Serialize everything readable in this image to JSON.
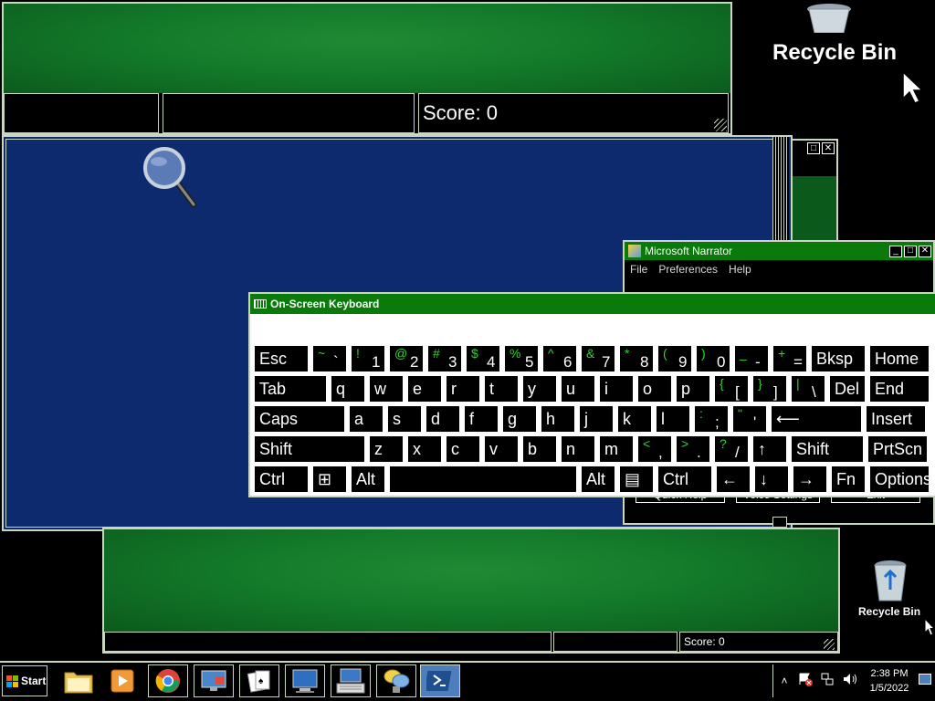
{
  "desktop": {
    "recycle_bin_top": "Recycle Bin",
    "recycle_bin_bottom": "Recycle Bin"
  },
  "solitaire_top": {
    "score": "Score: 0"
  },
  "solitaire_bottom": {
    "score": "Score: 0"
  },
  "osk": {
    "title": "On-Screen Keyboard",
    "rows": [
      [
        {
          "label": "Esc",
          "w": 60
        },
        {
          "shift": "~",
          "base": "`",
          "w": 38
        },
        {
          "shift": "!",
          "base": "1",
          "w": 38
        },
        {
          "shift": "@",
          "base": "2",
          "w": 38
        },
        {
          "shift": "#",
          "base": "3",
          "w": 38
        },
        {
          "shift": "$",
          "base": "4",
          "w": 38
        },
        {
          "shift": "%",
          "base": "5",
          "w": 38
        },
        {
          "shift": "^",
          "base": "6",
          "w": 38
        },
        {
          "shift": "&",
          "base": "7",
          "w": 38
        },
        {
          "shift": "*",
          "base": "8",
          "w": 38
        },
        {
          "shift": "(",
          "base": "9",
          "w": 38
        },
        {
          "shift": ")",
          "base": "0",
          "w": 38
        },
        {
          "shift": "_",
          "base": "-",
          "w": 38
        },
        {
          "shift": "+",
          "base": "=",
          "w": 38
        },
        {
          "label": "Bksp",
          "w": 60
        },
        {
          "label": "Home",
          "w": 66
        }
      ],
      [
        {
          "label": "Tab",
          "w": 80
        },
        {
          "label": "q",
          "w": 38
        },
        {
          "label": "w",
          "w": 38
        },
        {
          "label": "e",
          "w": 38
        },
        {
          "label": "r",
          "w": 38
        },
        {
          "label": "t",
          "w": 38
        },
        {
          "label": "y",
          "w": 38
        },
        {
          "label": "u",
          "w": 38
        },
        {
          "label": "i",
          "w": 38
        },
        {
          "label": "o",
          "w": 38
        },
        {
          "label": "p",
          "w": 38
        },
        {
          "shift": "{",
          "base": "[",
          "w": 38
        },
        {
          "shift": "}",
          "base": "]",
          "w": 38
        },
        {
          "shift": "|",
          "base": "\\",
          "w": 38
        },
        {
          "label": "Del",
          "w": 40
        },
        {
          "label": "End",
          "w": 66
        }
      ],
      [
        {
          "label": "Caps",
          "w": 100
        },
        {
          "label": "a",
          "w": 38
        },
        {
          "label": "s",
          "w": 38
        },
        {
          "label": "d",
          "w": 38
        },
        {
          "label": "f",
          "w": 38
        },
        {
          "label": "g",
          "w": 38
        },
        {
          "label": "h",
          "w": 38
        },
        {
          "label": "j",
          "w": 38
        },
        {
          "label": "k",
          "w": 38
        },
        {
          "label": "l",
          "w": 38
        },
        {
          "shift": ":",
          "base": ";",
          "w": 38
        },
        {
          "shift": "\"",
          "base": "'",
          "w": 38
        },
        {
          "label": "⟵",
          "w": 100
        },
        {
          "label": "Insert",
          "w": 66
        }
      ],
      [
        {
          "label": "Shift",
          "w": 122
        },
        {
          "label": "z",
          "w": 38
        },
        {
          "label": "x",
          "w": 38
        },
        {
          "label": "c",
          "w": 38
        },
        {
          "label": "v",
          "w": 38
        },
        {
          "label": "b",
          "w": 38
        },
        {
          "label": "n",
          "w": 38
        },
        {
          "label": "m",
          "w": 38
        },
        {
          "shift": "<",
          "base": ",",
          "w": 38
        },
        {
          "shift": ">",
          "base": ".",
          "w": 38
        },
        {
          "shift": "?",
          "base": "/",
          "w": 38
        },
        {
          "label": "↑",
          "w": 38
        },
        {
          "label": "Shift",
          "w": 80
        },
        {
          "label": "PrtScn",
          "w": 66
        }
      ],
      [
        {
          "label": "Ctrl",
          "w": 60
        },
        {
          "label": "⊞",
          "w": 38
        },
        {
          "label": "Alt",
          "w": 38
        },
        {
          "label": "",
          "w": 206
        },
        {
          "label": "Alt",
          "w": 38
        },
        {
          "label": "▤",
          "w": 38
        },
        {
          "label": "Ctrl",
          "w": 60
        },
        {
          "label": "←",
          "w": 38
        },
        {
          "label": "↓",
          "w": 38
        },
        {
          "label": "→",
          "w": 38
        },
        {
          "label": "Fn",
          "w": 38
        },
        {
          "label": "Options",
          "w": 66
        }
      ]
    ]
  },
  "narrator": {
    "title": "Microsoft Narrator",
    "menu": [
      "File",
      "Preferences",
      "Help"
    ],
    "buttons": [
      "Quick Help",
      "Voice Settings",
      "Exit"
    ]
  },
  "taskbar": {
    "start_label": "Start",
    "icons": [
      "folder-icon",
      "media-player-icon",
      "chrome-icon",
      "remote-desktop-icon",
      "solitaire-icon",
      "computer-icon",
      "keyboard-icon",
      "narrator-icon",
      "powershell-icon"
    ],
    "time": "2:38 PM",
    "date": "1/5/2022"
  }
}
